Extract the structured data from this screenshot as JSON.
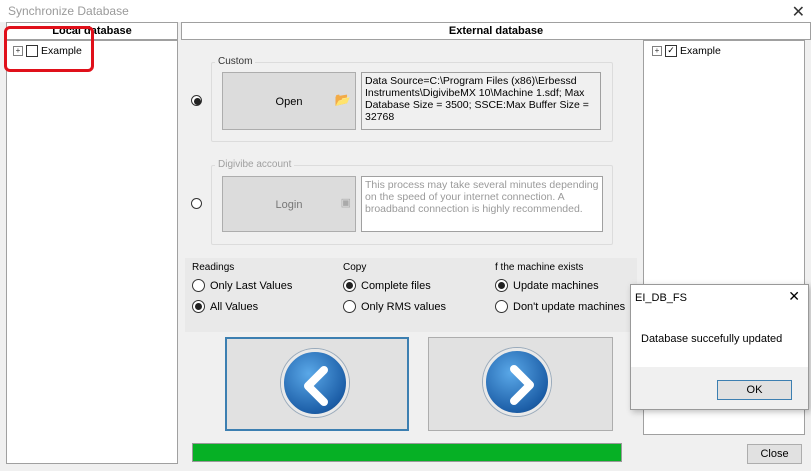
{
  "window": {
    "title": "Synchronize Database",
    "close_glyph": "✕"
  },
  "local": {
    "header": "Local database",
    "tree": [
      {
        "label": "Example",
        "checked": false
      }
    ]
  },
  "external": {
    "header": "External database"
  },
  "right_tree": [
    {
      "label": "Example",
      "checked": true
    }
  ],
  "custom": {
    "group_title": "Custom",
    "open_label": "Open",
    "connection_text": "Data Source=C:\\Program Files (x86)\\Erbessd Instruments\\DigivibeMX 10\\Machine 1.sdf; Max Database Size = 3500; SSCE:Max Buffer Size = 32768",
    "selected": true
  },
  "digivibe": {
    "group_title": "Digivibe account",
    "login_label": "Login",
    "note": "This process may take several minutes depending on the speed of your internet connection. A broadband connection is highly recommended.",
    "selected": false
  },
  "readings": {
    "title": "Readings",
    "options": [
      {
        "label": "Only Last Values",
        "selected": false
      },
      {
        "label": "All Values",
        "selected": true
      }
    ]
  },
  "copy": {
    "title": "Copy",
    "options": [
      {
        "label": "Complete files",
        "selected": true
      },
      {
        "label": "Only RMS values",
        "selected": false
      }
    ]
  },
  "machine": {
    "title": "f the machine exists",
    "options": [
      {
        "label": "Update machines",
        "selected": true
      },
      {
        "label": "Don't update machines",
        "selected": false
      }
    ]
  },
  "progress": {
    "value": 1.0,
    "color": "#06b025"
  },
  "close_button": "Close",
  "dialog": {
    "title": "EI_DB_FS",
    "message": "Database succefully updated",
    "ok": "OK",
    "close_glyph": "✕"
  },
  "colors": {
    "highlight": "#e0101a",
    "accent": "#3c7fb1"
  }
}
